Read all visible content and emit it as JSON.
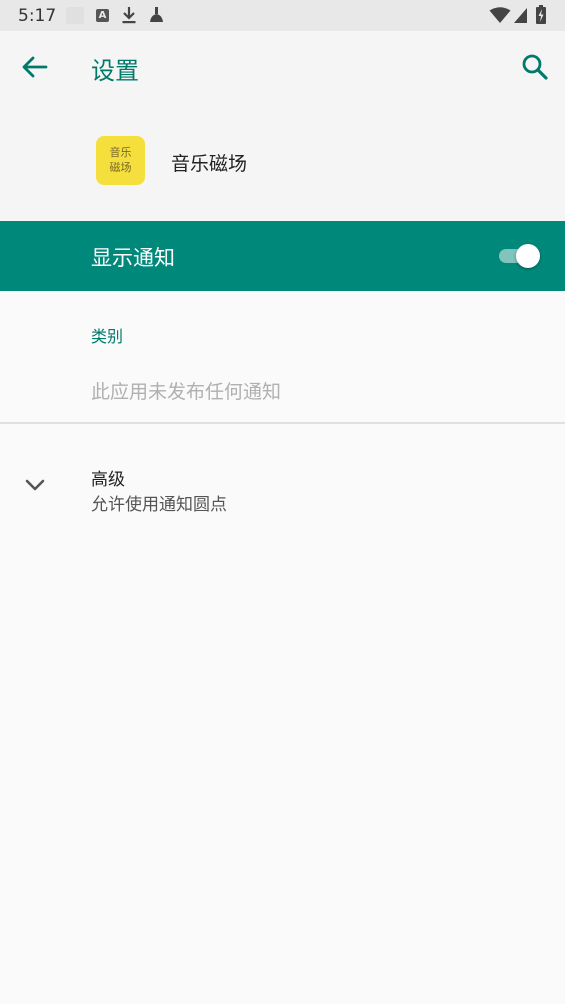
{
  "status_bar": {
    "time": "5:17",
    "icons": [
      "notification-placeholder-icon",
      "a-badge-icon",
      "download-icon",
      "cleaner-icon",
      "wifi-icon",
      "cell-signal-icon",
      "battery-charging-icon"
    ],
    "a_badge_letter": "A"
  },
  "app_bar": {
    "title": "设置",
    "back_icon": "arrow-back-icon",
    "search_icon": "search-icon"
  },
  "app_header": {
    "icon_text_line1": "音乐",
    "icon_text_line2": "磁场",
    "icon_color": "#f4df3d",
    "app_name": "音乐磁场"
  },
  "master_switch": {
    "label": "显示通知",
    "on": true,
    "background_color": "#00897b"
  },
  "category": {
    "header": "类别",
    "empty_text": "此应用未发布任何通知"
  },
  "advanced": {
    "title": "高级",
    "summary": "允许使用通知圆点",
    "icon": "chevron-down-icon"
  },
  "colors": {
    "accent": "#00796b",
    "screen_background": "#fafafa"
  }
}
